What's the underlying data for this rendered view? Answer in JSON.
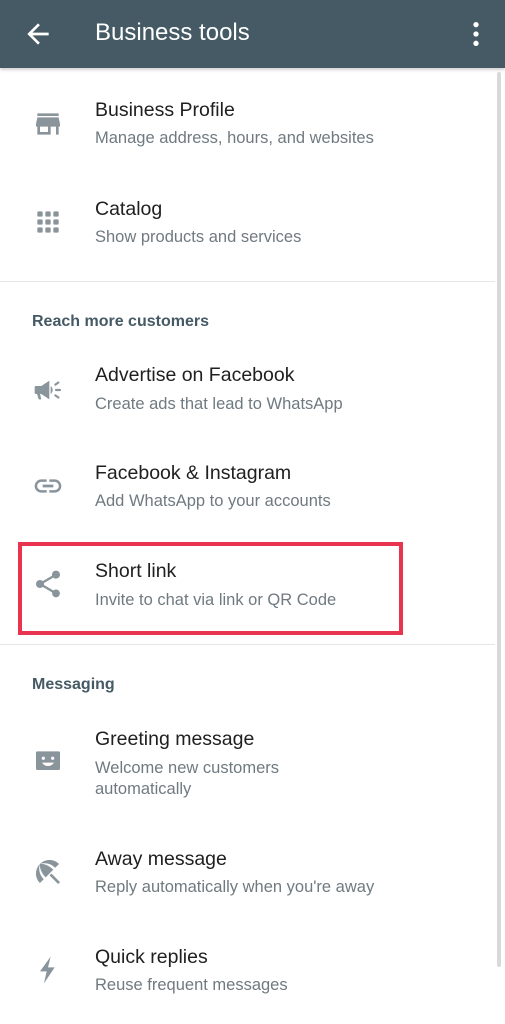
{
  "header": {
    "title": "Business tools"
  },
  "groups": [
    {
      "items": [
        {
          "title": "Business Profile",
          "subtitle": "Manage address, hours, and websites",
          "icon": "storefront-icon"
        },
        {
          "title": "Catalog",
          "subtitle": "Show products and services",
          "icon": "grid-icon"
        }
      ]
    },
    {
      "section": "Reach more customers",
      "items": [
        {
          "title": "Advertise on Facebook",
          "subtitle": "Create ads that lead to WhatsApp",
          "icon": "megaphone-icon"
        },
        {
          "title": "Facebook & Instagram",
          "subtitle": "Add WhatsApp to your accounts",
          "icon": "link-icon"
        },
        {
          "title": "Short link",
          "subtitle": "Invite to chat via link or QR Code",
          "icon": "share-icon",
          "highlighted": true
        }
      ]
    },
    {
      "section": "Messaging",
      "items": [
        {
          "title": "Greeting message",
          "subtitle": "Welcome new customers automatically",
          "icon": "greeting-message-icon"
        },
        {
          "title": "Away message",
          "subtitle": "Reply automatically when you're away",
          "icon": "beach-umbrella-icon"
        },
        {
          "title": "Quick replies",
          "subtitle": "Reuse frequent messages",
          "icon": "lightning-icon"
        }
      ]
    }
  ],
  "colors": {
    "appbar": "#455a64",
    "icon": "#8a959b",
    "highlight": "#e8344f"
  }
}
